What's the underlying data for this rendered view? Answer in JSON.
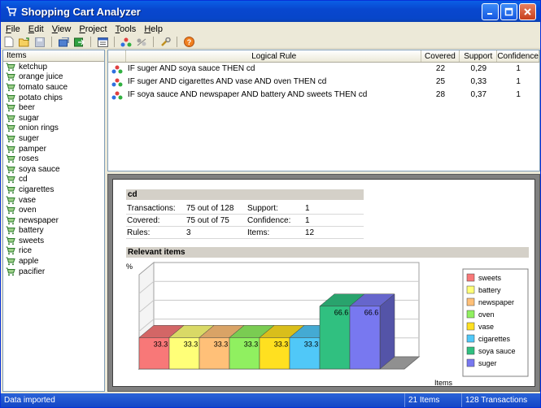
{
  "window": {
    "title": "Shopping Cart Analyzer"
  },
  "menu": [
    {
      "label": "File",
      "u": "F",
      "rest": "ile"
    },
    {
      "label": "Edit",
      "u": "E",
      "rest": "dit"
    },
    {
      "label": "View",
      "u": "V",
      "rest": "iew"
    },
    {
      "label": "Project",
      "u": "P",
      "rest": "roject"
    },
    {
      "label": "Tools",
      "u": "T",
      "rest": "ools"
    },
    {
      "label": "Help",
      "u": "H",
      "rest": "elp"
    }
  ],
  "items_panel": {
    "header": "Items",
    "items": [
      "ketchup",
      "orange juice",
      "tomato sauce",
      "potato chips",
      "beer",
      "sugar",
      "onion rings",
      "suger",
      "pamper",
      "roses",
      "soya sauce",
      "cd",
      "cigarettes",
      "vase",
      "oven",
      "newspaper",
      "battery",
      "sweets",
      "rice",
      "apple",
      "pacifier"
    ]
  },
  "rules_table": {
    "columns": [
      "Logical Rule",
      "Covered",
      "Support",
      "Confidence"
    ],
    "rows": [
      {
        "rule": "IF suger AND soya sauce THEN cd",
        "covered": "22",
        "support": "0,29",
        "confidence": "1"
      },
      {
        "rule": "IF suger AND cigarettes AND vase AND oven THEN cd",
        "covered": "25",
        "support": "0,33",
        "confidence": "1"
      },
      {
        "rule": "IF soya sauce AND newspaper AND battery AND sweets THEN cd",
        "covered": "28",
        "support": "0,37",
        "confidence": "1"
      }
    ]
  },
  "details": {
    "title": "cd",
    "transactions_label": "Transactions:",
    "transactions_value": "75 out of 128",
    "covered_label": "Covered:",
    "covered_value": "75 out of 75",
    "rules_label": "Rules:",
    "rules_value": "3",
    "support_label": "Support:",
    "support_value": "1",
    "confidence_label": "Confidence:",
    "confidence_value": "1",
    "items_label": "Items:",
    "items_value": "12",
    "relevant_title": "Relevant items"
  },
  "chart_data": {
    "type": "bar",
    "ylabel": "%",
    "xlabel": "Items",
    "categories": [
      "sweets",
      "battery",
      "newspaper",
      "oven",
      "vase",
      "cigarettes",
      "soya sauce",
      "suger"
    ],
    "values": [
      33.3,
      33.3,
      33.3,
      33.3,
      33.3,
      33.3,
      66.6,
      66.6
    ],
    "value_labels": [
      "33.3",
      "33.3",
      "33.3",
      "33.3",
      "33.3",
      "33.3",
      "66.6",
      "66.6"
    ],
    "colors": [
      "#F87878",
      "#FFFF78",
      "#FFC078",
      "#90F060",
      "#FFE020",
      "#50C8F8",
      "#30C080",
      "#7878F0"
    ],
    "ylim": [
      0,
      100
    ],
    "legend_position": "right"
  },
  "status": {
    "message": "Data imported",
    "items": "21 Items",
    "transactions": "128 Transactions"
  }
}
